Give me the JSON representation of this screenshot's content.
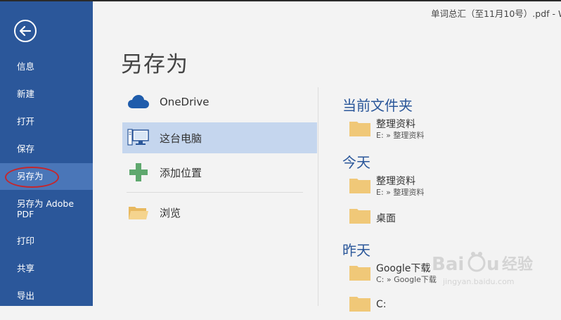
{
  "window": {
    "doc_title": "单词总汇（至11月10号）.pdf - W"
  },
  "sidebar": {
    "items": [
      {
        "label": "信息"
      },
      {
        "label": "新建"
      },
      {
        "label": "打开"
      },
      {
        "label": "保存"
      },
      {
        "label": "另存为",
        "active": true
      },
      {
        "label": "另存为 Adobe PDF"
      },
      {
        "label": "打印"
      },
      {
        "label": "共享"
      },
      {
        "label": "导出"
      }
    ]
  },
  "main": {
    "title": "另存为",
    "locations": [
      {
        "label": "OneDrive",
        "icon": "cloud-icon"
      },
      {
        "label": "这台电脑",
        "icon": "computer-icon",
        "selected": true
      },
      {
        "label": "添加位置",
        "icon": "plus-icon"
      },
      {
        "label": "浏览",
        "icon": "folder-icon"
      }
    ],
    "recent": {
      "current_folder": {
        "heading": "当前文件夹",
        "folders": [
          {
            "name": "整理资料",
            "path": "E: » 整理资料"
          }
        ]
      },
      "today": {
        "heading": "今天",
        "folders": [
          {
            "name": "整理资料",
            "path": "E: » 整理资料"
          },
          {
            "name": "桌面",
            "path": ""
          }
        ]
      },
      "yesterday": {
        "heading": "昨天",
        "folders": [
          {
            "name": "Google下载",
            "path": "C: » Google下载"
          },
          {
            "name": "C:",
            "path": ""
          }
        ]
      }
    }
  },
  "watermark": {
    "text": "Baidu 经验",
    "url": "jingyan.baidu.com"
  },
  "colors": {
    "sidebar": "#2b579a",
    "sidebar_active": "#4a76b8",
    "selected_location": "#c5d6ee",
    "heading": "#2b579a",
    "folder": "#f0c878"
  }
}
